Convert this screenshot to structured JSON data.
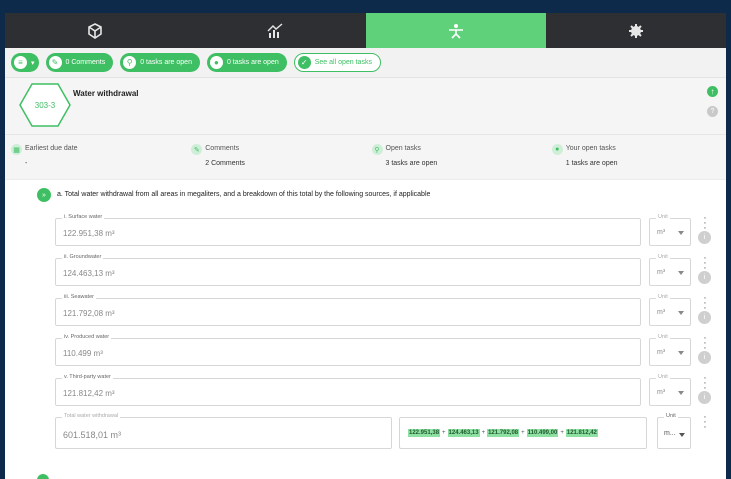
{
  "colors": {
    "accent": "#3fbf63",
    "nav_bg": "#2d2f33",
    "active_tab": "#5fd17a",
    "page_bg": "#0d2a4a"
  },
  "topnav": {
    "tabs": [
      {
        "icon": "cube-icon",
        "active": false
      },
      {
        "icon": "growth-chart-icon",
        "active": false
      },
      {
        "icon": "person-icon",
        "active": true
      },
      {
        "icon": "cog-icon",
        "active": false
      }
    ]
  },
  "pillbar": {
    "comments_label": "0 Comments",
    "tasks_open_label_1": "0 tasks are open",
    "tasks_open_label_2": "0 tasks are open",
    "see_all_label": "See all open tasks"
  },
  "disclosure": {
    "code": "303-3",
    "title": "Water withdrawal"
  },
  "stats": [
    {
      "label": "Earliest due date",
      "value": "-",
      "icon": "calendar-icon"
    },
    {
      "label": "Comments",
      "value": "2 Comments",
      "icon": "comments-icon"
    },
    {
      "label": "Open tasks",
      "value": "3 tasks are open",
      "icon": "pin-icon"
    },
    {
      "label": "Your open tasks",
      "value": "1 tasks are open",
      "icon": "user-task-icon"
    }
  ],
  "question": {
    "text": "a. Total water withdrawal from all areas in megaliters, and a breakdown of this total by the following sources, if applicable"
  },
  "rows": [
    {
      "label": "i. Surface water",
      "value": "122.951,38 m³",
      "unit_label": "Unit",
      "unit": "m³"
    },
    {
      "label": "ii. Groundwater",
      "value": "124.463,13 m³",
      "unit_label": "Unit",
      "unit": "m³"
    },
    {
      "label": "iii. Seawater",
      "value": "121.792,08 m³",
      "unit_label": "Unit",
      "unit": "m³"
    },
    {
      "label": "iv. Produced water",
      "value": "110.499 m³",
      "unit_label": "Unit",
      "unit": "m³"
    },
    {
      "label": "v. Third-party water",
      "value": "121.812,42 m³",
      "unit_label": "Unit",
      "unit": "m³"
    }
  ],
  "total": {
    "label": "Total water withdrawal",
    "value": "601.518,01 m³",
    "formula_terms": [
      "122.951,38",
      "124.463,13",
      "121.792,08",
      "110.499,00",
      "121.812,42"
    ],
    "formula_op": "+",
    "unit_label": "Unit",
    "unit": "m..."
  }
}
